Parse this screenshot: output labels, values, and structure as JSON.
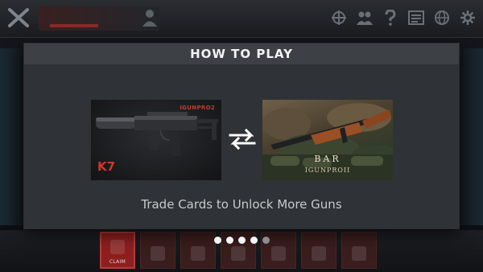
{
  "modal": {
    "title": "HOW TO PLAY",
    "caption": "Trade Cards to Unlock More Guns",
    "cards": [
      {
        "name": "K7",
        "code": "IGUNPRO2"
      },
      {
        "name": "BAR",
        "code": "IGUNPROII"
      }
    ],
    "pagination": {
      "total": 5,
      "active_count": 4
    }
  },
  "background": {
    "nav": [
      {
        "label": "CLAIM",
        "active": true
      },
      {
        "label": "",
        "active": false
      },
      {
        "label": "",
        "active": false
      },
      {
        "label": "",
        "active": false
      },
      {
        "label": "",
        "active": false
      },
      {
        "label": "",
        "active": false
      },
      {
        "label": "",
        "active": false
      }
    ]
  },
  "colors": {
    "accent_red": "#d8342a",
    "modal_header": "#3d4146",
    "modal_body": "#2f3236",
    "dot_active": "#f4f4f4",
    "dot_inactive": "#8a8d91"
  },
  "icons": {
    "swap": "swap-arrows-icon",
    "top_bar": [
      "crosshair-icon",
      "people-icon",
      "help-icon",
      "news-icon",
      "globe-icon",
      "gear-icon"
    ]
  }
}
